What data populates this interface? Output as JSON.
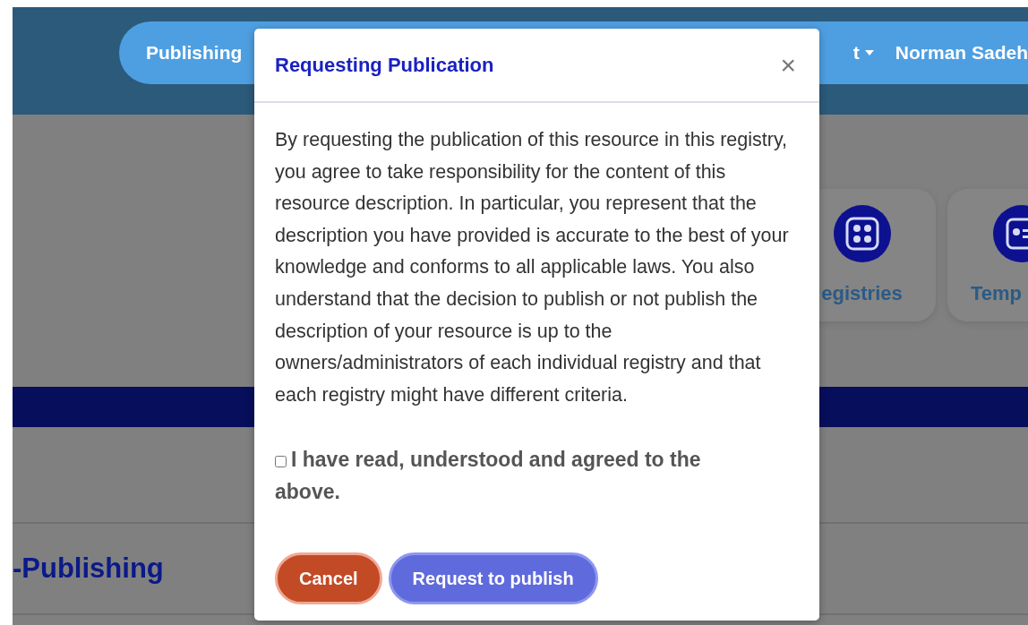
{
  "navbar": {
    "links": [
      {
        "label": "Publishing",
        "has_menu": false
      },
      {
        "label": "t",
        "has_menu": true
      },
      {
        "label": "Norman Sadeh",
        "has_menu": false
      }
    ]
  },
  "feature_cards": [
    {
      "label": "egistries",
      "kind": "registry"
    },
    {
      "label": "Temp",
      "kind": "template"
    }
  ],
  "section_heading": "-Publishing",
  "dialog": {
    "title": "Requesting Publication",
    "close": "×",
    "body": "By requesting the publication of this resource in this registry, you agree to take responsibility for the content of this resource description. In particular, you represent that the description you have provided is accurate to the best of your knowledge and conforms to all applicable laws. You also understand that the decision to publish or not publish the description of your resource is up to the owners/administrators of each individual registry and that each registry might have different criteria.",
    "agreement": {
      "label": "I have read, understood and agreed to the above.",
      "checked": false
    },
    "buttons": [
      {
        "label": "Cancel",
        "kind": "cancel"
      },
      {
        "label": "Request to publish",
        "kind": "primary"
      }
    ]
  }
}
